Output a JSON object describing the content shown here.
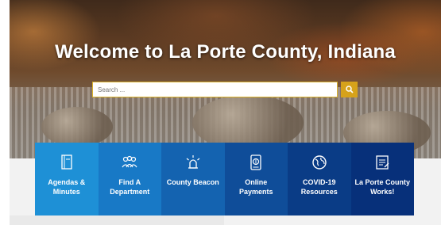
{
  "hero": {
    "title": "Welcome to La Porte County, Indiana"
  },
  "search": {
    "placeholder": "Search ...",
    "button_icon": "search-icon"
  },
  "tiles": [
    {
      "label": "Agendas & Minutes",
      "icon": "document-icon",
      "color": "#1e90d6"
    },
    {
      "label": "Find A Department",
      "icon": "people-icon",
      "color": "#1879c6"
    },
    {
      "label": "County Beacon",
      "icon": "beacon-icon",
      "color": "#1463b0"
    },
    {
      "label": "Online Payments",
      "icon": "payment-icon",
      "color": "#0f4d99"
    },
    {
      "label": "COVID-19 Resources",
      "icon": "globe-icon",
      "color": "#0a3c86"
    },
    {
      "label": "La Porte County Works!",
      "icon": "clipboard-icon",
      "color": "#07307a"
    }
  ],
  "colors": {
    "search_button": "#d6a21a",
    "search_border": "#d9b12b"
  }
}
